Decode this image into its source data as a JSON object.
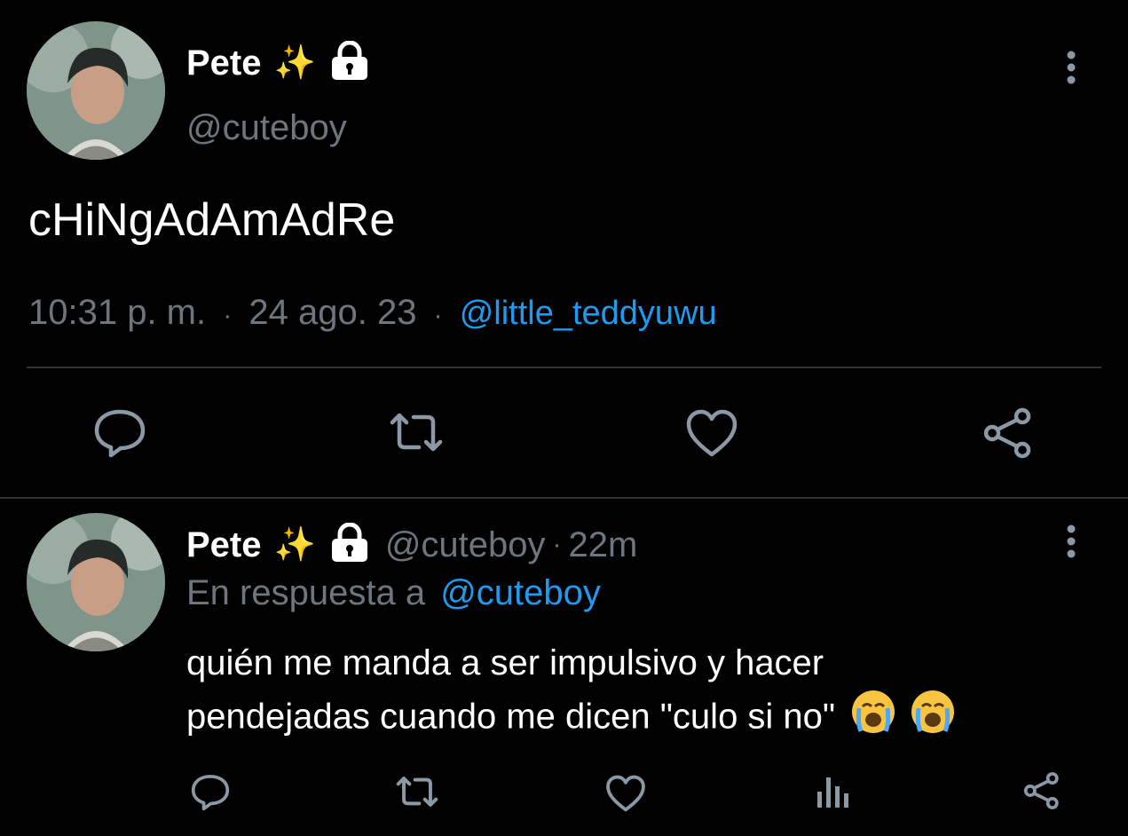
{
  "main_tweet": {
    "display_name": "Pete",
    "sparkles": "✨",
    "handle": "@cuteboy",
    "text": "cHiNgAdAmAdRe",
    "time": "10:31 p. m.",
    "separator": "·",
    "date": "24 ago. 23",
    "via": "@little_teddyuwu"
  },
  "reply_tweet": {
    "display_name": "Pete",
    "sparkles": "✨",
    "handle": "@cuteboy",
    "age": "22m",
    "separator": "·",
    "reply_prefix": "En respuesta a",
    "reply_to": "@cuteboy",
    "text_line1": "quién me manda a ser impulsivo y hacer",
    "text_line2": "pendejadas cuando me dicen \"culo si no\""
  },
  "colors": {
    "background": "#000000",
    "text": "#ffffff",
    "muted": "#6e767d",
    "link": "#1d9bf0",
    "divider": "#2f3336",
    "icon": "#8b98a5"
  },
  "icons": {
    "avatar": "profile-photo",
    "lock": "lock-icon",
    "more": "more-vertical-icon",
    "reply": "comment-icon",
    "retweet": "retweet-icon",
    "like": "heart-icon",
    "views": "analytics-icon",
    "share": "share-icon",
    "emoji": "loudly-crying-face"
  }
}
